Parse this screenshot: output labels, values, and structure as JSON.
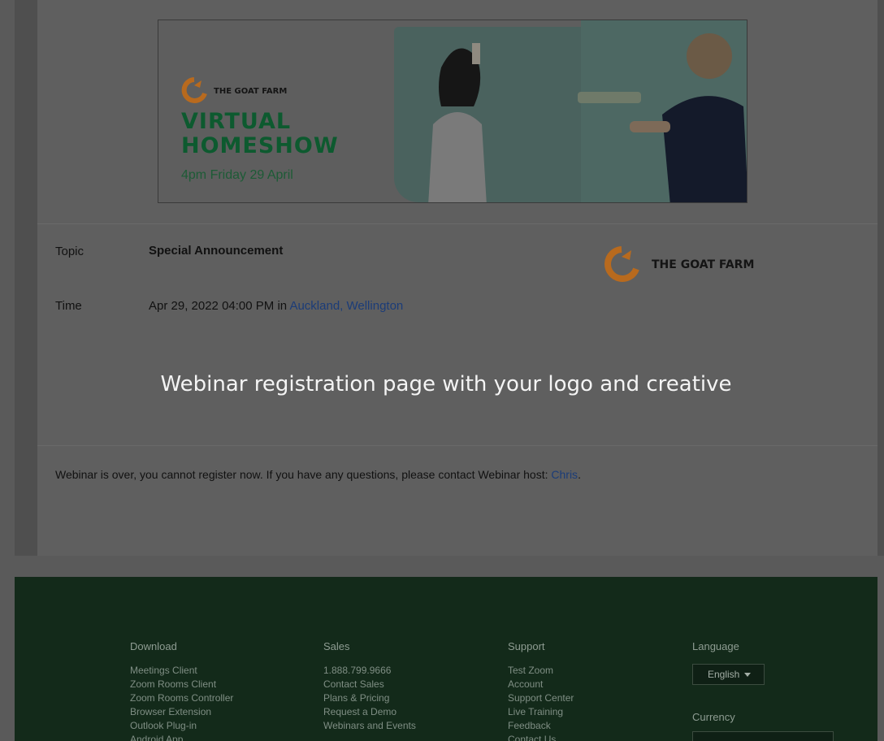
{
  "banner": {
    "brand_name": "THE GOAT FARM",
    "headline_line1": "VIRTUAL",
    "headline_line2": "HOMESHOW",
    "date_line": "4pm Friday 29 April"
  },
  "webinar": {
    "topic_label": "Topic",
    "topic_value": "Special Announcement",
    "time_label": "Time",
    "time_value": "Apr 29, 2022 04:00 PM in ",
    "time_zone_link": "Auckland, Wellington",
    "logo_name": "THE GOAT FARM"
  },
  "overlay_caption": "Webinar registration page with your logo and creative",
  "notice": {
    "text": "Webinar is over, you cannot register now. If you have any questions, please contact Webinar host: ",
    "host_link": "Chris",
    "trailing": "."
  },
  "footer": {
    "download": {
      "title": "Download",
      "items": [
        "Meetings Client",
        "Zoom Rooms Client",
        "Zoom Rooms Controller",
        "Browser Extension",
        "Outlook Plug-in",
        "Android App"
      ]
    },
    "sales": {
      "title": "Sales",
      "items": [
        "1.888.799.9666",
        "Contact Sales",
        "Plans & Pricing",
        "Request a Demo",
        "Webinars and Events"
      ]
    },
    "support": {
      "title": "Support",
      "items": [
        "Test Zoom",
        "Account",
        "Support Center",
        "Live Training",
        "Feedback",
        "Contact Us"
      ]
    },
    "language": {
      "title": "Language",
      "selected": "English",
      "currency_title": "Currency"
    }
  },
  "colors": {
    "brand_orange": "#b86a1e",
    "headline_green": "#0d5a2f",
    "link_blue": "#1b3c78",
    "footer_bg": "#132a1a"
  }
}
